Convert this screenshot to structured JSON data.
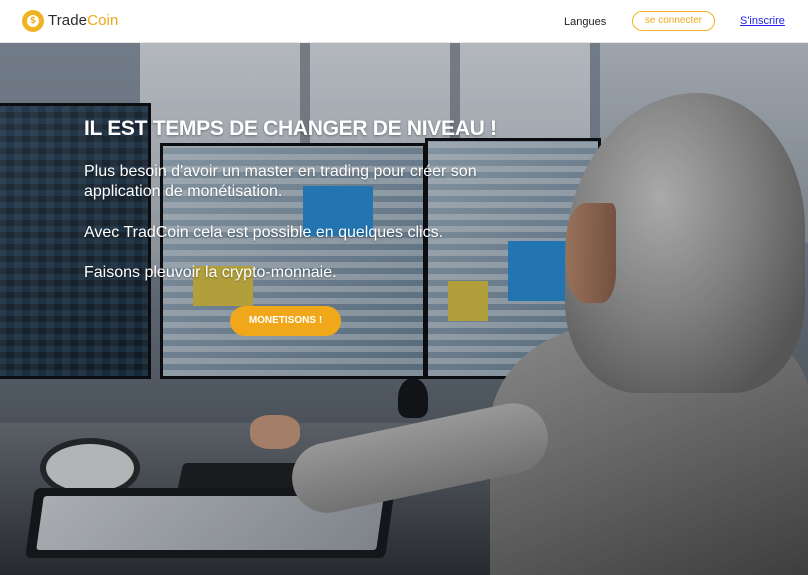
{
  "header": {
    "logo_text_a": "Trade",
    "logo_text_b": "Coin",
    "logo_mark_symbol": "$",
    "nav_langues": "Langues",
    "login_label": "se connecter",
    "signup_label": "S'inscrire"
  },
  "hero": {
    "title": "IL EST TEMPS DE CHANGER DE NIVEAU !",
    "line1": "Plus besoin d'avoir un master en trading pour créer son application de monétisation.",
    "line2": "Avec TradCoin cela est possible en quelques clics.",
    "line3": "Faisons pleuvoir la crypto-monnaie.",
    "cta_label": "MONETISONS !"
  },
  "colors": {
    "accent": "#f0a81a",
    "link": "#2323e6",
    "header_bg": "#ffffff"
  },
  "icons": {
    "logo": "coin-logo-icon"
  }
}
